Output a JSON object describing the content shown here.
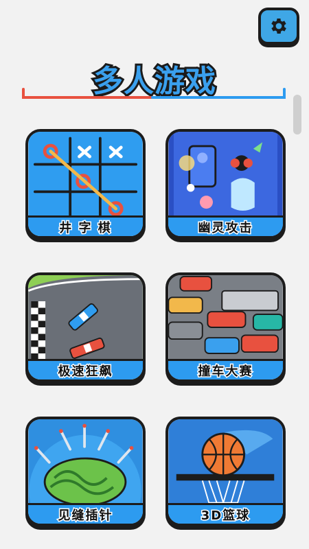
{
  "header": {
    "title": "多人游戏",
    "settings_icon": "gear-icon"
  },
  "colors": {
    "accent_blue": "#2d9bf0",
    "accent_red": "#e8513f",
    "outline": "#1c1c1c"
  },
  "games": [
    {
      "label": "井 字 棋",
      "icon": "tic-tac-toe-art"
    },
    {
      "label": "幽灵攻击",
      "icon": "ghost-attack-art"
    },
    {
      "label": "极速狂飙",
      "icon": "racing-art"
    },
    {
      "label": "撞车大赛",
      "icon": "car-crash-art"
    },
    {
      "label": "见缝插针",
      "icon": "knife-watermelon-art"
    },
    {
      "label": "3D篮球",
      "icon": "basketball-art"
    }
  ]
}
